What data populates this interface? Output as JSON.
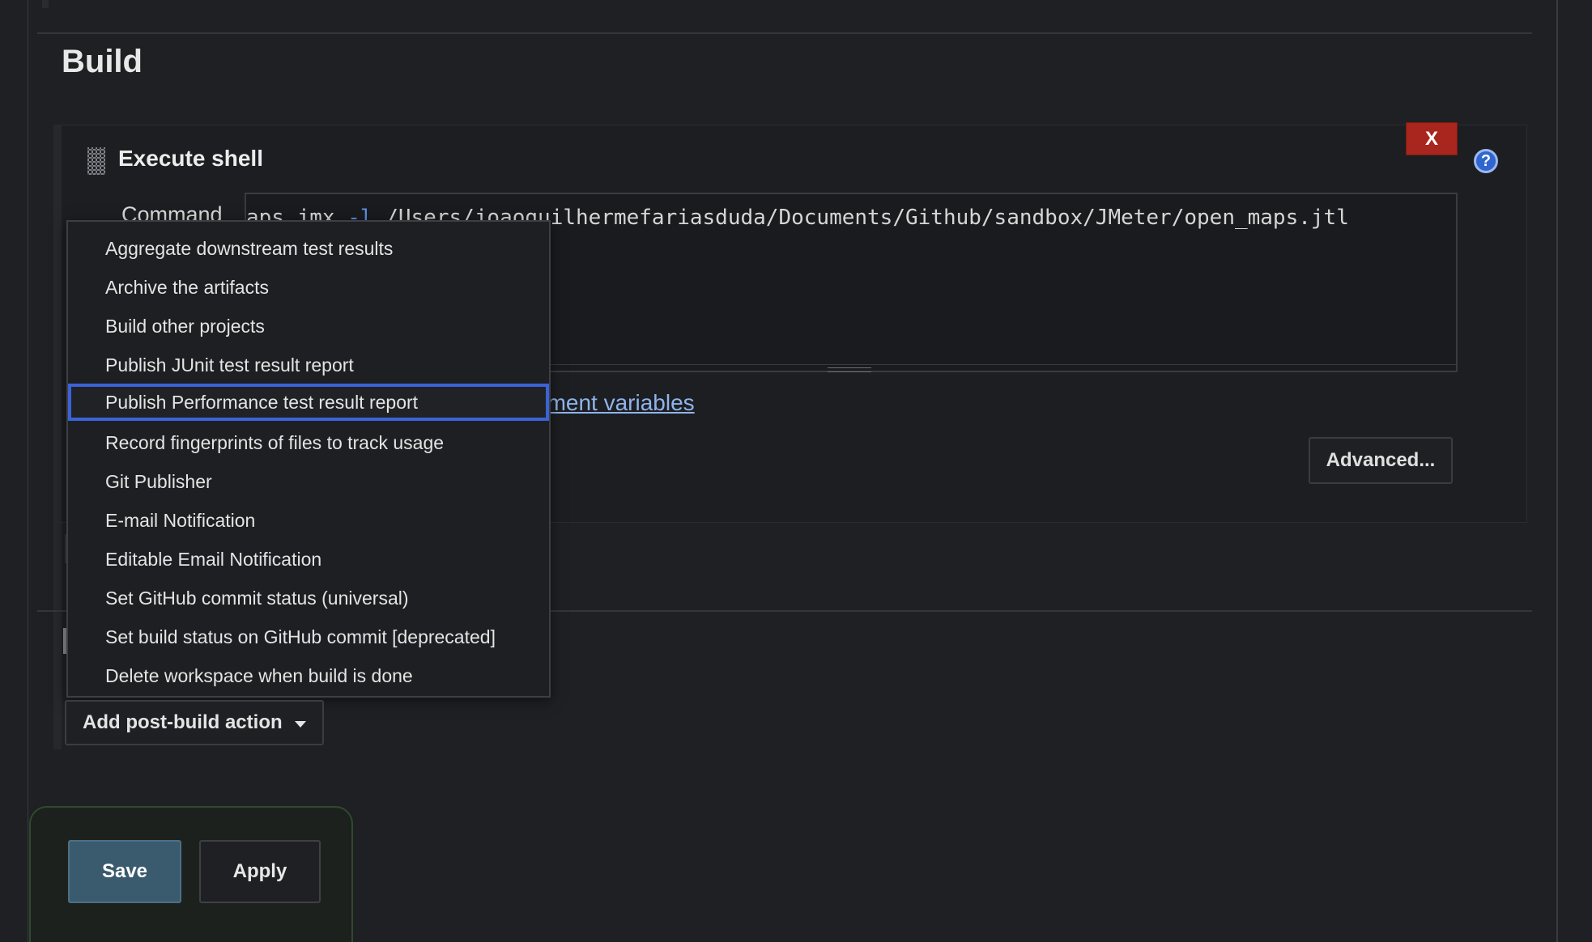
{
  "section": {
    "title": "Build"
  },
  "build_step": {
    "title": "Execute shell",
    "delete_label": "X",
    "help_label": "?",
    "command_label": "Command",
    "command_before_flag": "aps.jmx ",
    "command_flag": "-l",
    "command_after_flag": " /Users/joaoguilhermefariasduda/Documents/Github/sandbox/JMeter/open_maps.jtl",
    "env_link_text": "nment variables",
    "advanced_label": "Advanced..."
  },
  "post_build_menu": {
    "items": [
      "Aggregate downstream test results",
      "Archive the artifacts",
      "Build other projects",
      "Publish JUnit test result report",
      "Publish Performance test result report",
      "Record fingerprints of files to track usage",
      "Git Publisher",
      "E-mail Notification",
      "Editable Email Notification",
      "Set GitHub commit status (universal)",
      "Set build status on GitHub commit [deprecated]",
      "Delete workspace when build is done"
    ],
    "selected_index": 4,
    "button_label": "Add post-build action"
  },
  "actions": {
    "save_label": "Save",
    "apply_label": "Apply"
  },
  "colors": {
    "background": "#1f2023",
    "delete_button": "#a8261d",
    "help_icon": "#2f66d0",
    "selection_border": "#3b63d8",
    "save_button": "#3a5a6e",
    "link": "#8fb4ec"
  }
}
